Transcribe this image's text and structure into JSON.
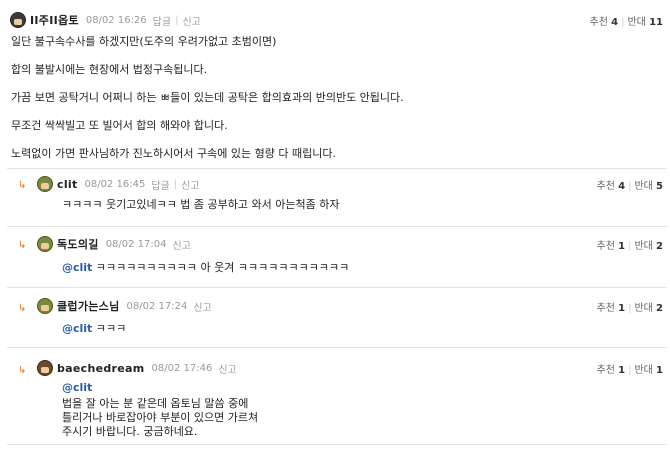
{
  "comments": [
    {
      "nickname": "II주II옵토",
      "date": "08/02 16:26",
      "reply_label": "답글",
      "report_label": "신고",
      "up_label": "추천",
      "up_count": "4",
      "down_label": "반대",
      "down_count": "11",
      "lines": [
        "일단 불구속수사를 하겠지만(도주의 우려가없고 초범이면)",
        "합의 불발시에는 현장에서 법정구속됩니다.",
        "가끔 보면 공탁거니 어쩌니 하는 ㅃ들이 있는데 공탁은 합의효과의 반의반도 안됩니다.",
        "무조건 싹싹빌고 또 빌어서 합의 해와야 합니다.",
        "노력없이 가면 판사님하가 진노하시어서 구속에 있는 형량 다 때립니다."
      ]
    },
    {
      "nickname": "clit",
      "date": "08/02 16:45",
      "reply_label": "답글",
      "report_label": "신고",
      "up_label": "추천",
      "up_count": "4",
      "down_label": "반대",
      "down_count": "5",
      "lines": [
        "ㅋㅋㅋㅋ 웃기고있네ㅋㅋ 법 좀 공부하고 와서 아는척좀 하자"
      ]
    },
    {
      "nickname": "독도의길",
      "date": "08/02 17:04",
      "report_label": "신고",
      "up_label": "추천",
      "up_count": "1",
      "down_label": "반대",
      "down_count": "2",
      "mention": "@clit",
      "text": "ㅋㅋㅋㅋㅋㅋㅋㅋㅋㅋ 아 웃겨 ㅋㅋㅋㅋㅋㅋㅋㅋㅋㅋㅋ"
    },
    {
      "nickname": "클럽가는스님",
      "date": "08/02 17:24",
      "report_label": "신고",
      "up_label": "추천",
      "up_count": "1",
      "down_label": "반대",
      "down_count": "2",
      "mention": "@clit",
      "text": "ㅋㅋㅋ"
    },
    {
      "nickname": "baechedream",
      "date": "08/02 17:46",
      "report_label": "신고",
      "up_label": "추천",
      "up_count": "1",
      "down_label": "반대",
      "down_count": "1",
      "mention": "@clit",
      "lines": [
        "법을 잘 아는 분 같은데 옵토님 말씀 중에",
        "틀리거나 바로잡아야 부분이 있으면 가르쳐",
        "주시기 바랍니다. 궁금하네요."
      ]
    }
  ],
  "icons": {
    "reply_arrow": "reply-arrow-icon",
    "avatar": "avatar-icon"
  },
  "colors": {
    "reply_arrow": "#e8741c",
    "mention": "#2a5db0",
    "separator": "#e4e4e4"
  }
}
